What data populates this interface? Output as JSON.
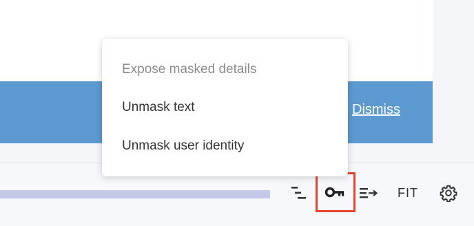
{
  "banner": {
    "dismiss_label": "Dismiss"
  },
  "toolbar": {
    "fit_label": "FIT",
    "icons": [
      "tree-outline-icon",
      "key-icon",
      "wrap-lines-icon",
      "settings-gear-icon"
    ],
    "highlight_color": "#e6442c"
  },
  "menu": {
    "header": "Expose masked details",
    "items": [
      {
        "label": "Unmask text"
      },
      {
        "label": "Unmask user identity"
      }
    ]
  },
  "colors": {
    "banner": "#5b99d0",
    "progress": "#c3c9e6"
  }
}
